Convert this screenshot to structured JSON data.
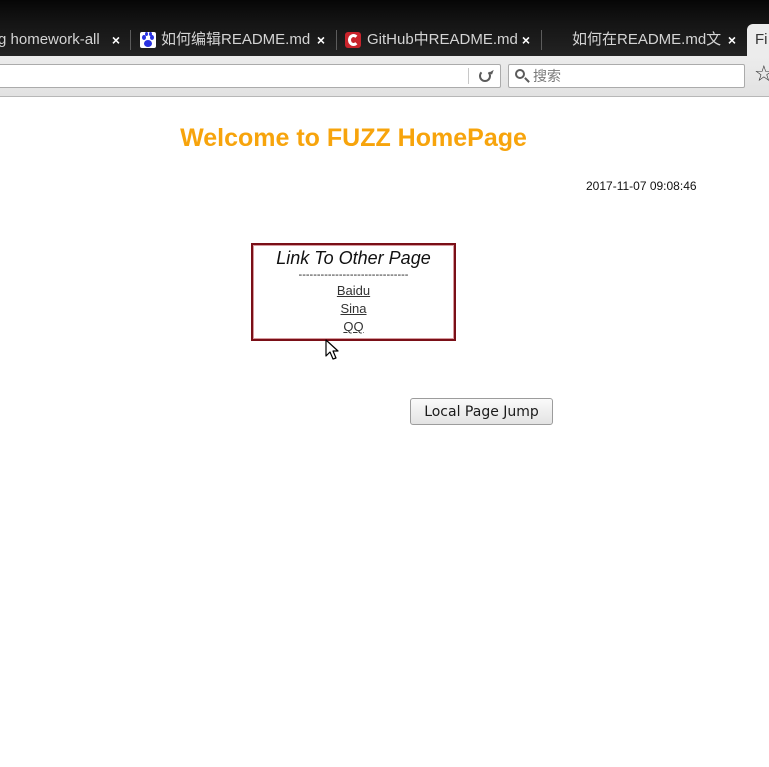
{
  "browser": {
    "tabs": [
      {
        "title": "g homework-all",
        "favicon": "none"
      },
      {
        "title": "如何编辑README.md",
        "favicon": "baidu-paw-icon"
      },
      {
        "title": "GitHub中README.md",
        "favicon": "csdn-icon"
      },
      {
        "title": "如何在README.md文",
        "favicon": "none"
      }
    ],
    "active_tab_title": "Fi",
    "close_glyph": "×",
    "search_placeholder": "搜索",
    "bookmark_glyph": "☆"
  },
  "page": {
    "title": "Welcome to FUZZ HomePage",
    "title_color": "#f7a40c",
    "datetime": "2017-11-07 09:08:46",
    "link_box": {
      "heading": "Link To Other Page",
      "divider": "------------------------------",
      "links": [
        "Baidu",
        "Sina",
        "QQ"
      ],
      "border_color": "#7a0f17"
    },
    "jump_button_label": "Local Page Jump"
  }
}
